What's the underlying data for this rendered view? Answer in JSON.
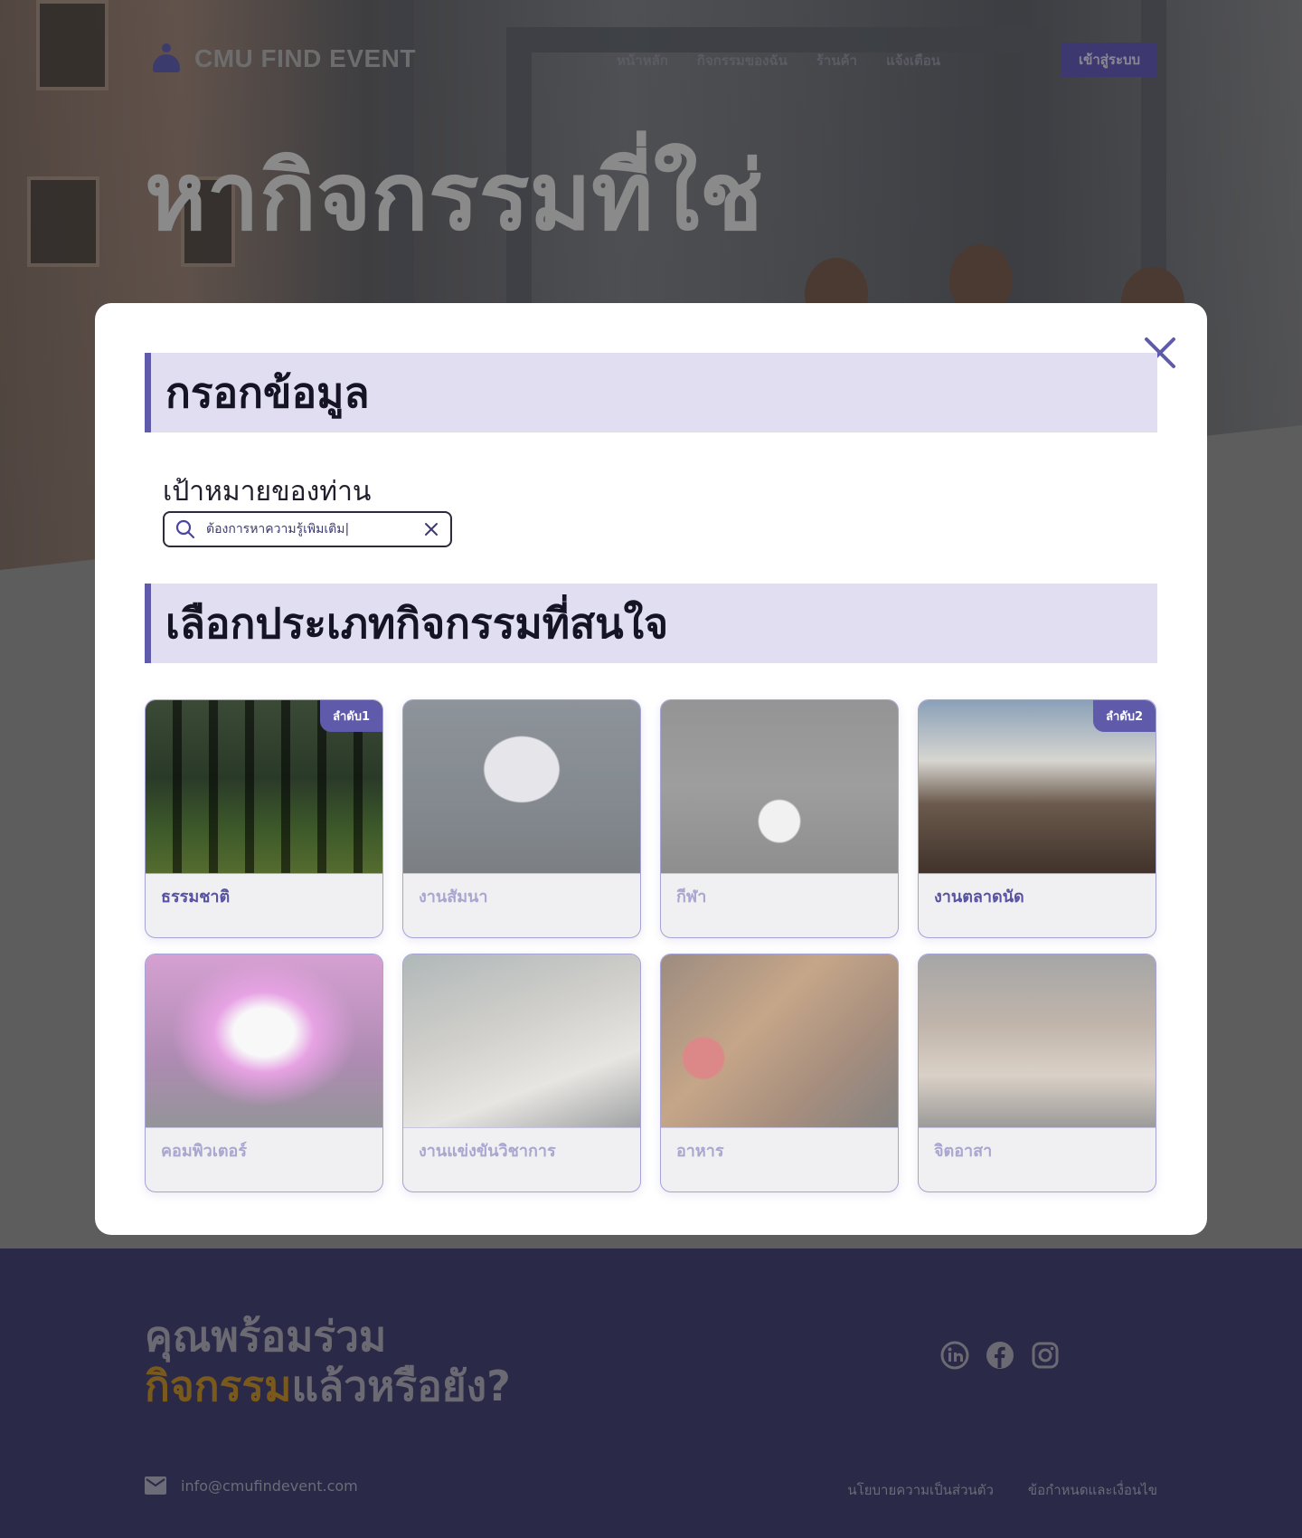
{
  "site": {
    "logo_text": "CMU FIND EVENT",
    "nav": [
      "หน้าหลัก",
      "กิจกรรมของฉัน",
      "ร้านค้า",
      "แจ้งเตือน"
    ],
    "login_label": "เข้าสู่ระบบ",
    "hero_title": "หากิจกรรมที่ใช่"
  },
  "modal": {
    "section1_title": "กรอกข้อมูล",
    "goal_label": "เป้าหมายของท่าน",
    "goal_value": "ต้องการหาความรู้เพิ่มเติม|",
    "section2_title": "เลือกประเภทกิจกรรมที่สนใจ",
    "categories": [
      {
        "label": "ธรรมชาติ",
        "badge": "ลำดับ1",
        "selected": true,
        "icon": "forest-photo"
      },
      {
        "label": "งานสัมนา",
        "badge": "",
        "selected": false,
        "icon": "seminar-photo"
      },
      {
        "label": "กีฬา",
        "badge": "",
        "selected": false,
        "icon": "sport-photo"
      },
      {
        "label": "งานตลาดนัด",
        "badge": "ลำดับ2",
        "selected": true,
        "icon": "market-photo"
      },
      {
        "label": "คอมพิวเตอร์",
        "badge": "",
        "selected": false,
        "icon": "computer-photo"
      },
      {
        "label": "งานแข่งขันวิชาการ",
        "badge": "",
        "selected": false,
        "icon": "study-photo"
      },
      {
        "label": "อาหาร",
        "badge": "",
        "selected": false,
        "icon": "food-photo"
      },
      {
        "label": "จิตอาสา",
        "badge": "",
        "selected": false,
        "icon": "volunteer-photo"
      }
    ]
  },
  "footer": {
    "title_line1": "คุณพร้อมร่วม",
    "title_accent": "กิจกรรม",
    "title_rest": "แล้วหรือยัง?",
    "email": "info@cmufindevent.com",
    "links": [
      "นโยบายความเป็นส่วนตัว",
      "ข้อกำหนดและเงื่อนไข"
    ]
  },
  "colors": {
    "accent": "#5f5aa9",
    "header_bg": "#e0def0",
    "footer_bg": "#2a2947"
  }
}
